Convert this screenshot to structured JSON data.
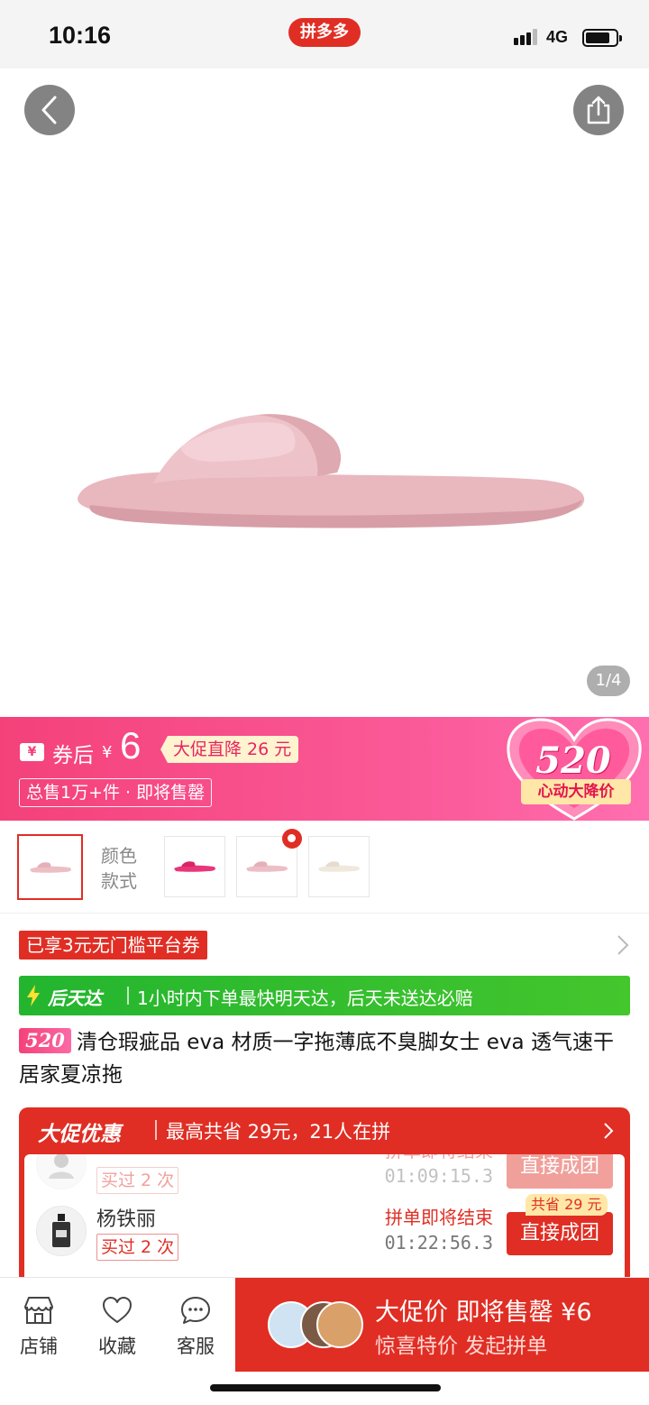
{
  "status_bar": {
    "time": "10:16",
    "app_name": "拼多多",
    "network": "4G"
  },
  "gallery": {
    "page_indicator": "1/4",
    "back_icon": "chevron-left-icon",
    "share_icon": "share-icon"
  },
  "promo": {
    "coupon_icon": "¥",
    "after_coupon_label": "券后",
    "yen": "¥",
    "price": "6",
    "drop_tag": "大促直降 26 元",
    "sold_tag": "总售1万+件 · 即将售罄",
    "heart_number": "520",
    "heart_label": "心动大降价"
  },
  "variants": {
    "label_line1": "颜色",
    "label_line2": "款式"
  },
  "platform_coupon": "已享3元无门槛平台券",
  "delivery": {
    "title": "后天达",
    "text": "1小时内下单最快明天达，后天未送达必赔"
  },
  "product": {
    "tag": "520",
    "title": "清仓瑕疵品 eva 材质一字拖薄底不臭脚女士 eva 透气速干居家夏凉拖"
  },
  "group": {
    "title": "大促优惠",
    "subtitle": "最高共省 29元，21人在拼",
    "members": [
      {
        "name": "",
        "bought": "买过 2 次",
        "status": "拼单即将结束",
        "time": "01:09:15.3",
        "join": "直接成团"
      },
      {
        "name": "杨铁丽",
        "bought": "买过 2 次",
        "status": "拼单即将结束",
        "time": "01:22:56.3",
        "join": "直接成团",
        "save": "共省 29 元"
      }
    ]
  },
  "bottom_bar": {
    "tabs": [
      {
        "label": "店铺",
        "icon": "store-icon"
      },
      {
        "label": "收藏",
        "icon": "heart-icon"
      },
      {
        "label": "客服",
        "icon": "chat-icon"
      }
    ],
    "buy_line1": "大促价 即将售罄 ¥6",
    "buy_line2": "惊喜特价 发起拼单"
  },
  "colors": {
    "brand_red": "#e02e24",
    "promo_pink": "#f4417a",
    "delivery_green": "#23b52f"
  }
}
